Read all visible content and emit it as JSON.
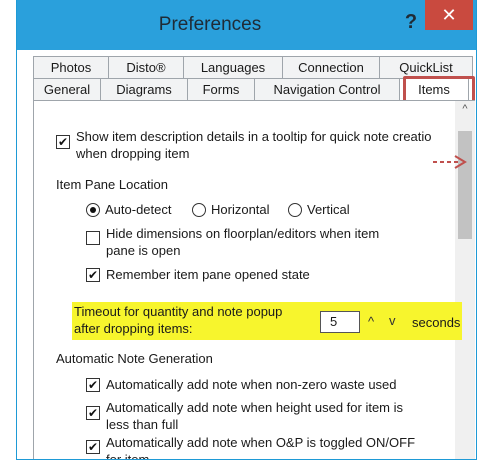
{
  "window": {
    "title": "Preferences",
    "help_label": "?",
    "close_label": "✕",
    "titlebar_color": "#2aa0dc",
    "close_color": "#c94a3f"
  },
  "tabs": {
    "row1": [
      "Photos",
      "Disto®",
      "Languages",
      "Connection",
      "QuickList"
    ],
    "row2": [
      "General",
      "Diagrams",
      "Forms",
      "Navigation Control",
      "Items"
    ],
    "active": "Items",
    "highlight_color": "#c0504d"
  },
  "settings": {
    "tooltip_option": {
      "line1": "Show item description details in a tooltip for quick note creatio",
      "line2": "when dropping item",
      "checked": true
    },
    "item_pane_location": {
      "label": "Item Pane Location",
      "options": [
        "Auto-detect",
        "Horizontal",
        "Vertical"
      ],
      "selected": "Auto-detect"
    },
    "hide_dimensions": {
      "line1": "Hide dimensions on floorplan/editors when item",
      "line2": "pane is open",
      "checked": false
    },
    "remember_pane": {
      "label": "Remember item pane opened state",
      "checked": true
    },
    "timeout": {
      "line1": "Timeout for quantity and note popup",
      "line2": "after dropping items:",
      "value": "5",
      "up_label": "^",
      "down_label": "v",
      "unit": "seconds",
      "highlight_color": "#f7f52d"
    },
    "auto_note": {
      "label": "Automatic Note Generation",
      "waste": {
        "label": "Automatically add note when non-zero waste used",
        "checked": true
      },
      "height": {
        "line1": "Automatically add note when height used for item is",
        "line2": "less than full",
        "checked": true
      },
      "op": {
        "line1": "Automatically add note when O&P is toggled ON/OFF",
        "line2": "for item",
        "checked": true
      }
    }
  },
  "annotation": {
    "arrow_color": "#c0504d",
    "icon": "dashed-arrow-icon"
  },
  "scroll": {
    "up_label": "^"
  }
}
